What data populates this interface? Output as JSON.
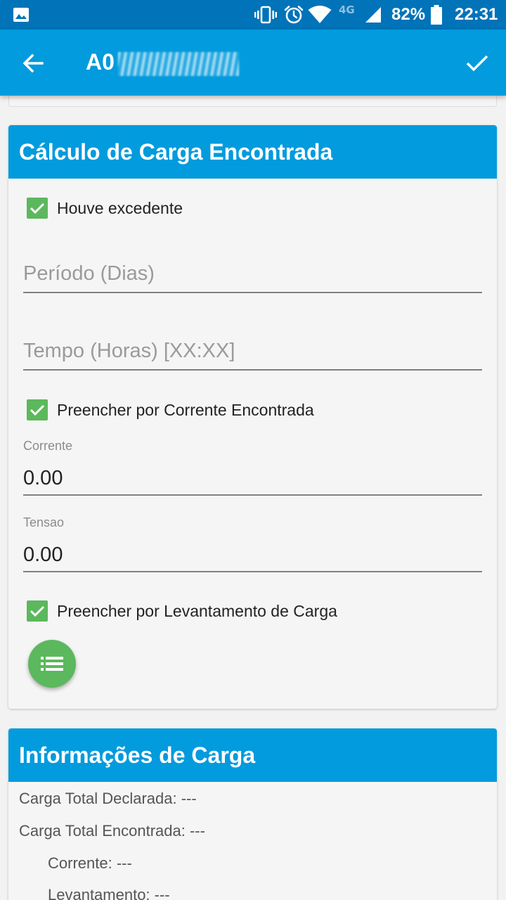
{
  "status_bar": {
    "battery_percent": "82%",
    "time": "22:31",
    "network": "4G",
    "icons": [
      "image-icon",
      "vibrate-icon",
      "alarm-icon",
      "wifi-icon",
      "signal-icon",
      "battery-icon"
    ]
  },
  "app_bar": {
    "title": "A0",
    "icons": [
      "back-arrow-icon",
      "check-icon"
    ]
  },
  "card_calculo": {
    "header": "Cálculo de Carga Encontrada",
    "houve_excedente": {
      "label": "Houve excedente",
      "checked": true
    },
    "periodo": {
      "placeholder": "Período (Dias)",
      "value": ""
    },
    "tempo": {
      "placeholder": "Tempo (Horas) [XX:XX]",
      "value": ""
    },
    "preencher_corrente": {
      "label": "Preencher por Corrente Encontrada",
      "checked": true
    },
    "corrente": {
      "label": "Corrente",
      "value": "0.00"
    },
    "tensao": {
      "label": "Tensao",
      "value": "0.00"
    },
    "preencher_levantamento": {
      "label": "Preencher por Levantamento de Carga",
      "checked": true
    },
    "fab_icon": "list-icon"
  },
  "card_informacoes": {
    "header": "Informações de Carga",
    "rows": [
      {
        "label": "Carga Total Declarada: ---"
      },
      {
        "label": "Carga Total Encontrada: ---"
      },
      {
        "label": "Corrente: ---"
      },
      {
        "label": "Levantamento: ---"
      }
    ]
  },
  "colors": {
    "status_bar": "#0173b9",
    "primary": "#029bdd",
    "checkbox": "#5cb85c",
    "background": "#f2f2f2"
  }
}
